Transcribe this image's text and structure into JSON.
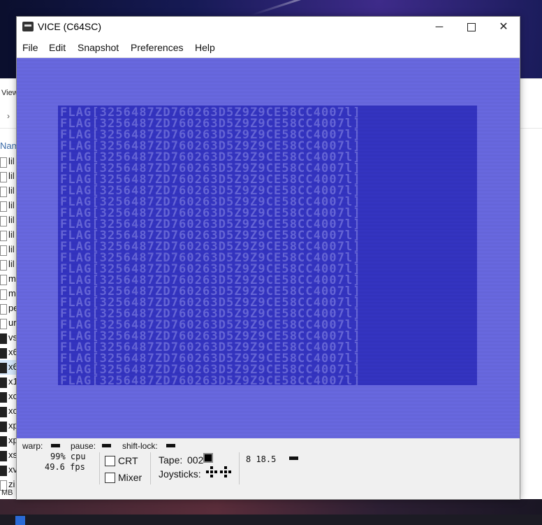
{
  "window": {
    "title": "VICE (C64SC)",
    "controls": {
      "minimize": "─",
      "close": "✕"
    }
  },
  "menu": [
    "File",
    "Edit",
    "Snapshot",
    "Preferences",
    "Help"
  ],
  "screen": {
    "lines": [
      "FLAG[3256487ZD760263D5Z9Z9CE58CC4007l]",
      "FLAG[3256487ZD760263D5Z9Z9CE58CC4007l]",
      "FLAG[3256487ZD760263D5Z9Z9CE58CC4007l]",
      "FLAG[3256487ZD760263D5Z9Z9CE58CC4007l]",
      "FLAG[3256487ZD760263D5Z9Z9CE58CC4007l]",
      "FLAG[3256487ZD760263D5Z9Z9CE58CC4007l]",
      "FLAG[3256487ZD760263D5Z9Z9CE58CC4007l]",
      "FLAG[3256487ZD760263D5Z9Z9CE58CC4007l]",
      "FLAG[3256487ZD760263D5Z9Z9CE58CC4007l]",
      "FLAG[3256487ZD760263D5Z9Z9CE58CC4007l]",
      "FLAG[3256487ZD760263D5Z9Z9CE58CC4007l]",
      "FLAG[3256487ZD760263D5Z9Z9CE58CC4007l]",
      "FLAG[3256487ZD760263D5Z9Z9CE58CC4007l]",
      "FLAG[3256487ZD760263D5Z9Z9CE58CC4007l]",
      "FLAG[3256487ZD760263D5Z9Z9CE58CC4007l]",
      "FLAG[3256487ZD760263D5Z9Z9CE58CC4007l]",
      "FLAG[3256487ZD760263D5Z9Z9CE58CC4007l]",
      "FLAG[3256487ZD760263D5Z9Z9CE58CC4007l]",
      "FLAG[3256487ZD760263D5Z9Z9CE58CC4007l]",
      "FLAG[3256487ZD760263D5Z9Z9CE58CC4007l]",
      "FLAG[3256487ZD760263D5Z9Z9CE58CC4007l]",
      "FLAG[3256487ZD760263D5Z9Z9CE58CC4007l]",
      "FLAG[3256487ZD760263D5Z9Z9CE58CC4007l]",
      "FLAG[3256487ZD760263D5Z9Z9CE58CC4007l]",
      "FLAG[3256487ZD760263D5Z9Z9CE58CC4007l]"
    ],
    "border_color": "#6c6ce8",
    "background_color": "#3636c8",
    "text_color": "#6a6ae0"
  },
  "status": {
    "warp_label": "warp:",
    "pause_label": "pause:",
    "shift_lock_label": "shift-lock:",
    "cpu": "99% cpu",
    "fps": "49.6 fps",
    "crt_label": "CRT",
    "crt_checked": false,
    "mixer_label": "Mixer",
    "mixer_checked": false,
    "tape_label": "Tape:",
    "tape_counter": "002",
    "joysticks_label": "Joysticks:",
    "drive_status": "8 18.5"
  },
  "background_window": {
    "view_label": "View",
    "name_label": "Nam",
    "row_labels": [
      "lil",
      "lil",
      "lil",
      "lil",
      "lil",
      "lil",
      "lil",
      "lil",
      "m",
      "m",
      "pe",
      "ur",
      "vs",
      "x6",
      "x6",
      "x1",
      "xc",
      "xc",
      "xp",
      "xp",
      "xs",
      "xv",
      "zi"
    ],
    "footer": "MB"
  }
}
